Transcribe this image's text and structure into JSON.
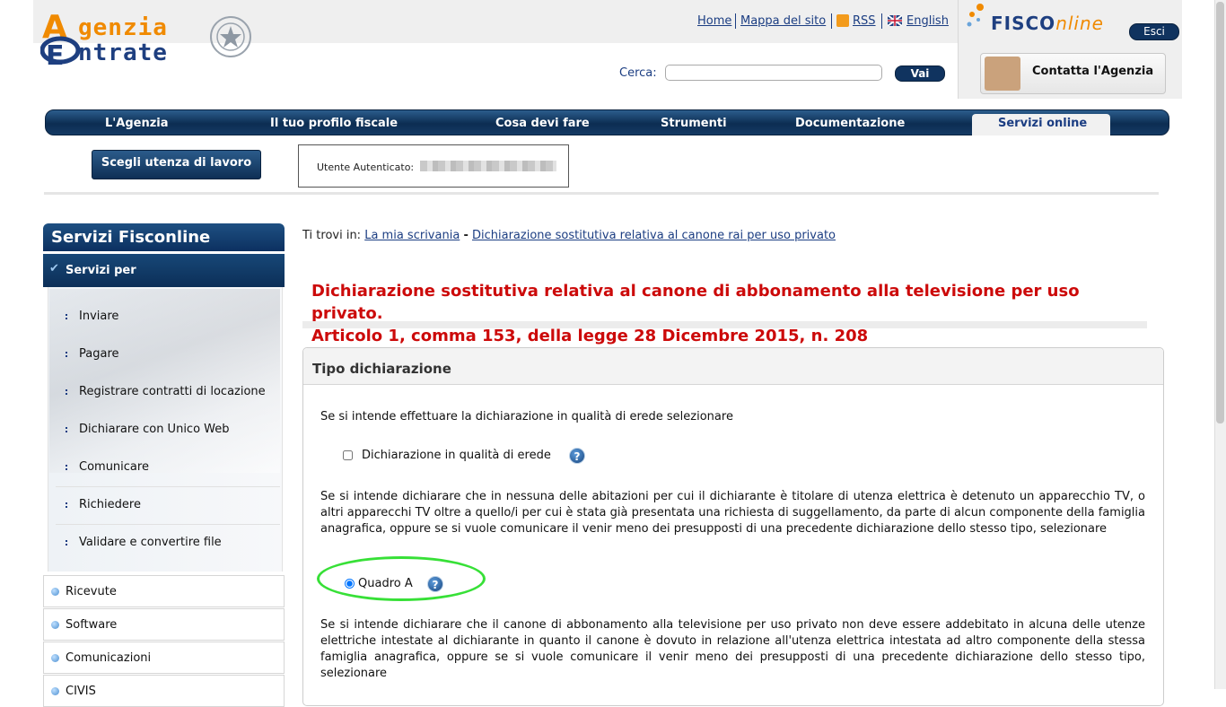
{
  "header": {
    "logo_line1": "genzia",
    "logo_line2": "ntrate",
    "links": {
      "home": "Home",
      "sitemap": "Mappa del sito",
      "rss": "RSS",
      "english": "English"
    },
    "search_label": "Cerca:",
    "search_placeholder": "",
    "search_button": "Vai",
    "fisco_brand_1": "FISCO",
    "fisco_brand_2": "nline",
    "logout_button": "Esci",
    "contact_button": "Contatta l'Agenzia"
  },
  "nav": {
    "items": [
      "L'Agenzia",
      "Il tuo profilo fiscale",
      "Cosa devi fare",
      "Strumenti",
      "Documentazione",
      "Servizi online"
    ],
    "active": "Servizi online"
  },
  "workbar": {
    "choose_button": "Scegli utenza di lavoro",
    "user_label": "Utente Autenticato:"
  },
  "sidebar": {
    "title": "Servizi Fisconline",
    "section": "Servizi per",
    "items": [
      "Inviare",
      "Pagare",
      "Registrare contratti di locazione",
      "Dichiarare con Unico Web",
      "Comunicare",
      "Richiedere",
      "Validare e convertire file"
    ],
    "boxes": [
      "Ricevute",
      "Software",
      "Comunicazioni",
      "CIVIS"
    ]
  },
  "breadcrumb": {
    "prefix": "Ti trovi in:",
    "link1": "La mia scrivania",
    "separator": "-",
    "link2": "Dichiarazione sostitutiva relativa al canone rai per uso privato"
  },
  "main": {
    "title_line1": "Dichiarazione sostitutiva relativa al canone di abbonamento alla televisione per uso privato.",
    "title_line2": "Articolo 1, comma 153, della legge 28 Dicembre 2015, n. 208",
    "panel_title": "Tipo dichiarazione",
    "para1": "Se si intende effettuare la dichiarazione in qualità di erede selezionare",
    "erede_label": "Dichiarazione in qualità di erede",
    "para2": "Se si intende dichiarare che in nessuna delle abitazioni per cui il dichiarante è titolare di utenza elettrica è detenuto un apparecchio TV, o altri apparecchi TV oltre a quello/i per cui è stata già presentata una richiesta di suggellamento, da parte di alcun componente della famiglia anagrafica, oppure se si vuole comunicare il venir meno dei presupposti di una precedente dichiarazione dello stesso tipo, selezionare",
    "quadro_a_label": "Quadro A",
    "para3": "Se si intende dichiarare che il canone di abbonamento alla televisione per uso privato non deve essere addebitato in alcuna delle utenze elettriche intestate al dichiarante in quanto il canone è dovuto in relazione all'utenza elettrica intestata ad altro componente della stessa famiglia anagrafica, oppure se si vuole comunicare il venir meno dei presupposti di una precedente dichiarazione dello stesso tipo, selezionare",
    "help_glyph": "?"
  },
  "colors": {
    "brand_blue": "#1b3d82",
    "brand_orange": "#f08a00",
    "title_red": "#cc0a0a",
    "highlight_green": "#37e037"
  }
}
